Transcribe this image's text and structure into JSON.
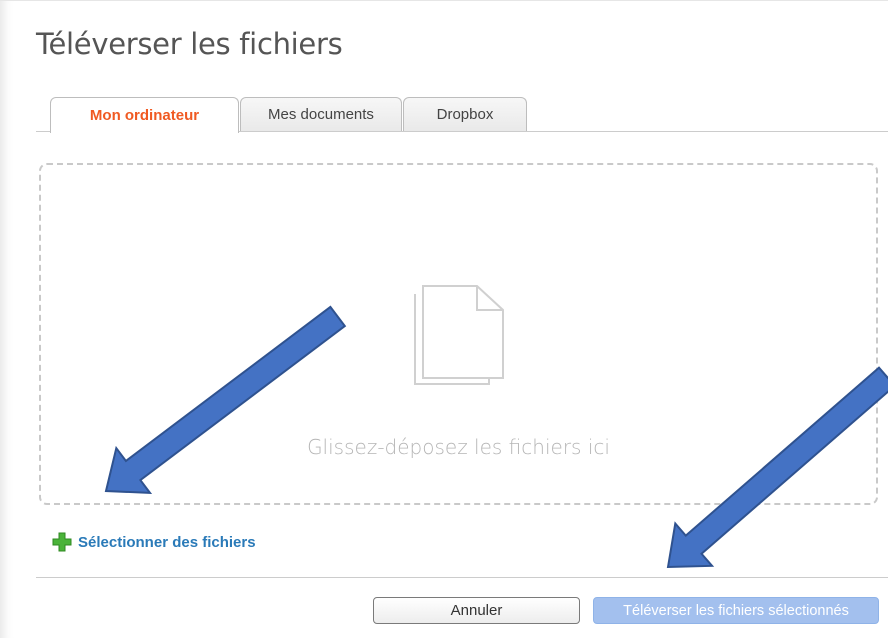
{
  "dialog": {
    "title": "Téléverser les fichiers"
  },
  "tabs": [
    {
      "label": "Mon ordinateur",
      "active": true
    },
    {
      "label": "Mes documents",
      "active": false
    },
    {
      "label": "Dropbox",
      "active": false
    }
  ],
  "dropzone": {
    "icon": "file-icon",
    "text": "Glissez-déposez les fichiers ici"
  },
  "select_files": {
    "icon": "plus-icon",
    "label": "Sélectionner des fichiers"
  },
  "buttons": {
    "cancel": "Annuler",
    "upload": "Téléverser les fichiers sélectionnés"
  },
  "colors": {
    "accent": "#f05a22",
    "link": "#2a7ab8",
    "plus": "#4bb33a",
    "upload_disabled": "#a3c0ee",
    "annotation_arrow": "#4472c4"
  }
}
